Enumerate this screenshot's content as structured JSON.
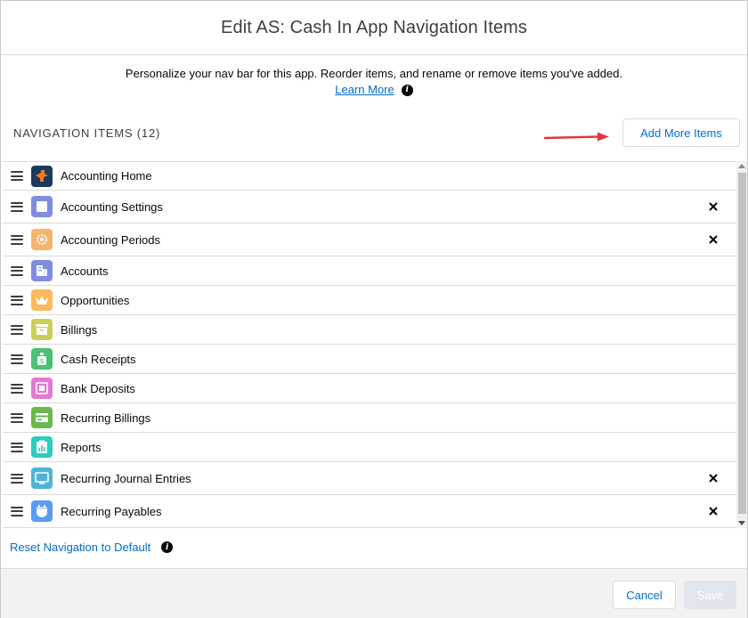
{
  "modal": {
    "title": "Edit AS: Cash In App Navigation Items",
    "intro_text": "Personalize your nav bar for this app. Reorder items, and rename or remove items you've added.",
    "learn_more": "Learn More"
  },
  "nav": {
    "section_label": "NAVIGATION ITEMS (12)",
    "add_more_label": "Add More Items",
    "items": [
      {
        "label": "Accounting Home",
        "icon": "accounting-home-icon",
        "color": "#1b3a5c",
        "removable": false
      },
      {
        "label": "Accounting Settings",
        "icon": "settings-square-icon",
        "color": "#7f8de1",
        "removable": true
      },
      {
        "label": "Accounting Periods",
        "icon": "gear-icon",
        "color": "#f4b56f",
        "removable": true
      },
      {
        "label": "Accounts",
        "icon": "building-icon",
        "color": "#7f8de1",
        "removable": false
      },
      {
        "label": "Opportunities",
        "icon": "crown-icon",
        "color": "#fcb95b",
        "removable": false
      },
      {
        "label": "Billings",
        "icon": "archive-box-icon",
        "color": "#c9d05a",
        "removable": false
      },
      {
        "label": "Cash Receipts",
        "icon": "money-bag-icon",
        "color": "#4bc076",
        "removable": false
      },
      {
        "label": "Bank Deposits",
        "icon": "safe-icon",
        "color": "#e279d4",
        "removable": false
      },
      {
        "label": "Recurring Billings",
        "icon": "card-icon",
        "color": "#6ab84d",
        "removable": false
      },
      {
        "label": "Reports",
        "icon": "report-icon",
        "color": "#2ecbbe",
        "removable": false
      },
      {
        "label": "Recurring Journal Entries",
        "icon": "monitor-icon",
        "color": "#4fb3d9",
        "removable": true
      },
      {
        "label": "Recurring Payables",
        "icon": "shield-calendar-icon",
        "color": "#5b9bf0",
        "removable": true
      }
    ]
  },
  "footer": {
    "reset_label": "Reset Navigation to Default",
    "cancel_label": "Cancel",
    "save_label": "Save"
  },
  "colors": {
    "link": "#006dcc",
    "annotation_arrow": "#e03a3a"
  }
}
